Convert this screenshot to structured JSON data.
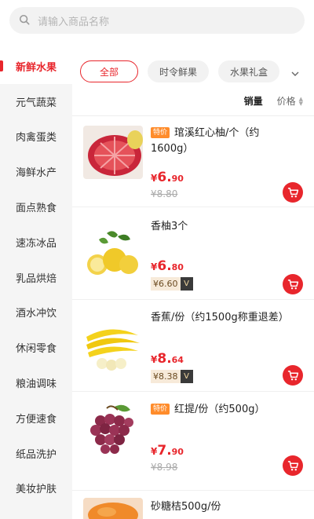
{
  "search": {
    "placeholder": "请输入商品名称",
    "icon": "search-icon"
  },
  "sidebar": {
    "items": [
      {
        "label": "新鲜水果",
        "active": true
      },
      {
        "label": "元气蔬菜"
      },
      {
        "label": "肉禽蛋类"
      },
      {
        "label": "海鲜水产"
      },
      {
        "label": "面点熟食"
      },
      {
        "label": "速冻冰品"
      },
      {
        "label": "乳品烘焙"
      },
      {
        "label": "酒水冲饮"
      },
      {
        "label": "休闲零食"
      },
      {
        "label": "粮油调味"
      },
      {
        "label": "方便速食"
      },
      {
        "label": "纸品洗护"
      },
      {
        "label": "美妆护肤"
      }
    ]
  },
  "tabs": [
    {
      "label": "全部",
      "active": true
    },
    {
      "label": "时令鲜果"
    },
    {
      "label": "水果礼盒"
    }
  ],
  "sort": {
    "sales_label": "销量",
    "price_label": "价格"
  },
  "products": [
    {
      "tag": "特价",
      "name": "琯溪红心柚/个（约1600g）",
      "price_symbol": "¥",
      "price_int": "6.",
      "price_dec": "90",
      "old_price": "¥8.80",
      "vip_price": "",
      "thumb": "pomelo"
    },
    {
      "tag": "",
      "name": "香柚3个",
      "price_symbol": "¥",
      "price_int": "6.",
      "price_dec": "80",
      "old_price": "",
      "vip_price": "¥6.60",
      "vip_badge": "V",
      "thumb": "citron"
    },
    {
      "tag": "",
      "name": "香蕉/份（约1500g称重退差）",
      "price_symbol": "¥",
      "price_int": "8.",
      "price_dec": "64",
      "old_price": "",
      "vip_price": "¥8.38",
      "vip_badge": "V",
      "thumb": "banana"
    },
    {
      "tag": "特价",
      "name": "红提/份（约500g）",
      "price_symbol": "¥",
      "price_int": "7.",
      "price_dec": "90",
      "old_price": "¥8.98",
      "vip_price": "",
      "thumb": "grapes"
    },
    {
      "tag": "",
      "name": "砂糖桔500g/份",
      "thumb": "orange"
    }
  ],
  "colors": {
    "accent": "#e8262c",
    "tag": "#ff8c2b"
  }
}
